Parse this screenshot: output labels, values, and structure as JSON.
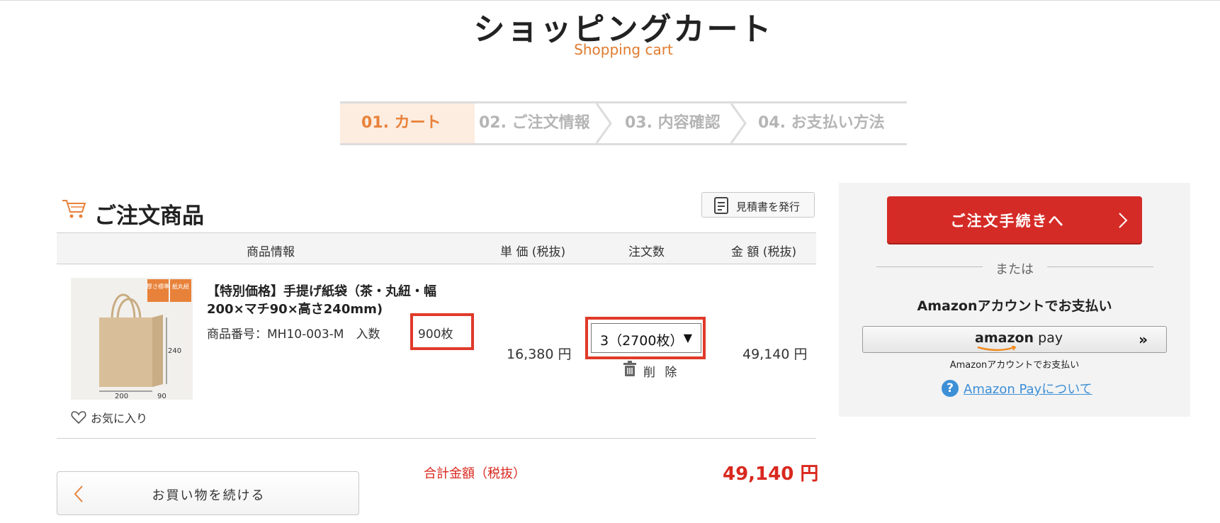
{
  "header": {
    "title": "ショッピングカート",
    "subtitle": "Shopping cart"
  },
  "steps": [
    {
      "label": "01. カート",
      "active": true
    },
    {
      "label": "02. ご注文情報",
      "active": false
    },
    {
      "label": "03. 内容確認",
      "active": false
    },
    {
      "label": "04. お支払い方法",
      "active": false
    }
  ],
  "cart": {
    "section_title": "ご注文商品",
    "estimate_button": "見積書を発行",
    "columns": {
      "product": "商品情報",
      "unit_price": "単 価 (税抜)",
      "quantity": "注文数",
      "amount": "金 額 (税抜)"
    },
    "item": {
      "name_line1": "【特別価格】手提げ紙袋（茶・丸紐・幅",
      "name_line2": "200×マチ90×高さ240mm)",
      "code": "商品番号：MH10-003-M　入数",
      "pack_quantity": "900枚",
      "image_tags": [
        "厚さ標準",
        "紙丸紐"
      ],
      "image_dims": {
        "width": "200",
        "height": "240",
        "depth": "90"
      },
      "favorite": "お気に入り",
      "unit_price": "16,380 円",
      "quantity_selected": "3（2700枚）",
      "delete": "削 除",
      "amount": "49,140 円"
    },
    "total_label": "合計金額（税抜）",
    "total_value": "49,140 円",
    "continue_button": "お買い物を続ける"
  },
  "sidebar": {
    "checkout_button": "ご注文手続きへ",
    "or_text": "または",
    "amazon_heading": "Amazonアカウントでお支払い",
    "amazon_logo": "amazon",
    "amazon_pay": " pay",
    "amazon_note": "Amazonアカウントでお支払い",
    "amazon_link": "Amazon Payについて"
  },
  "colors": {
    "accent_orange": "#e8823a",
    "checkout_red": "#d52b26",
    "highlight_red": "#e03a2a",
    "link_blue": "#3d8fd6"
  }
}
